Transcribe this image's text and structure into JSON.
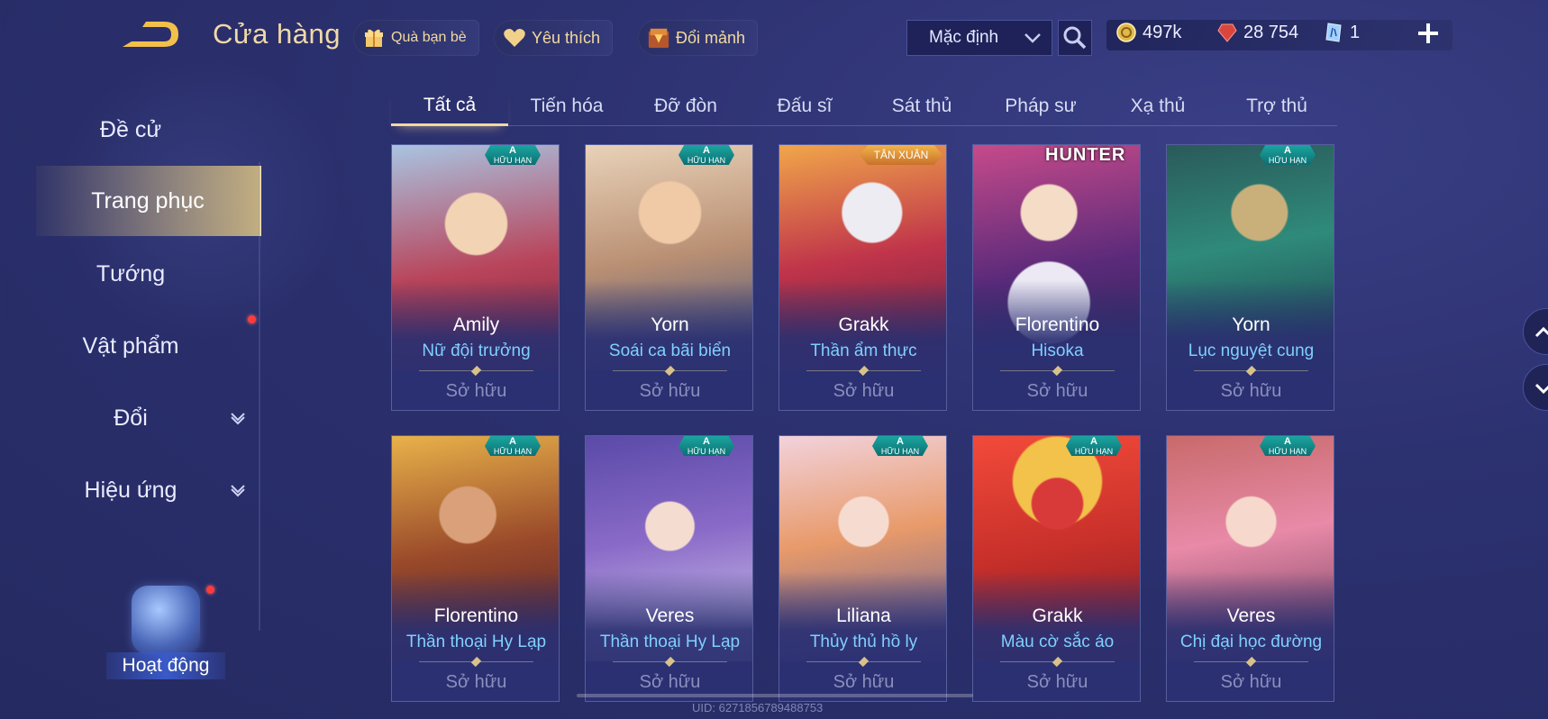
{
  "header": {
    "title": "Cửa hàng",
    "friend_gift": "Quà bạn bè",
    "favorites": "Yêu thích",
    "exchange_shards": "Đổi mảnh",
    "sort_selected": "Mặc định",
    "currency": {
      "gold": "497k",
      "vouchers": "28 754",
      "tickets": "1"
    }
  },
  "sidebar": {
    "items": [
      {
        "label": "Đề cử"
      },
      {
        "label": "Trang phục"
      },
      {
        "label": "Tướng"
      },
      {
        "label": "Vật phẩm"
      },
      {
        "label": "Đổi"
      },
      {
        "label": "Hiệu ứng"
      }
    ],
    "activity_label": "Hoạt động"
  },
  "tabs": [
    {
      "label": "Tất cả"
    },
    {
      "label": "Tiến hóa"
    },
    {
      "label": "Đỡ đòn"
    },
    {
      "label": "Đấu sĩ"
    },
    {
      "label": "Sát thủ"
    },
    {
      "label": "Pháp sư"
    },
    {
      "label": "Xạ thủ"
    },
    {
      "label": "Trợ thủ"
    }
  ],
  "badges": {
    "rank": "A",
    "limited": "HỮU HẠN",
    "new_year": "TÂN XUÂN",
    "hunter": "HUNTER"
  },
  "cards": [
    {
      "hero": "Amily",
      "skin": "Nữ đội trưởng",
      "status": "Sở hữu"
    },
    {
      "hero": "Yorn",
      "skin": "Soái ca bãi biển",
      "status": "Sở hữu"
    },
    {
      "hero": "Grakk",
      "skin": "Thần ẩm thực",
      "status": "Sở hữu"
    },
    {
      "hero": "Florentino",
      "skin": "Hisoka",
      "status": "Sở hữu"
    },
    {
      "hero": "Yorn",
      "skin": "Lục nguyệt cung",
      "status": "Sở hữu"
    },
    {
      "hero": "Florentino",
      "skin": "Thần thoại Hy Lạp",
      "status": "Sở hữu"
    },
    {
      "hero": "Veres",
      "skin": "Thần thoại Hy Lạp",
      "status": "Sở hữu"
    },
    {
      "hero": "Liliana",
      "skin": "Thủy thủ hồ ly",
      "status": "Sở hữu"
    },
    {
      "hero": "Grakk",
      "skin": "Màu cờ sắc áo",
      "status": "Sở hữu"
    },
    {
      "hero": "Veres",
      "skin": "Chị đại học đường",
      "status": "Sở hữu"
    }
  ],
  "uid_text": "UID: 6271856789488753",
  "colors": {
    "accent_gold": "#f1d9a6",
    "skin_name": "#7fd0ff",
    "owned_status": "#8990bd",
    "notify_red": "#ff3b3b"
  }
}
